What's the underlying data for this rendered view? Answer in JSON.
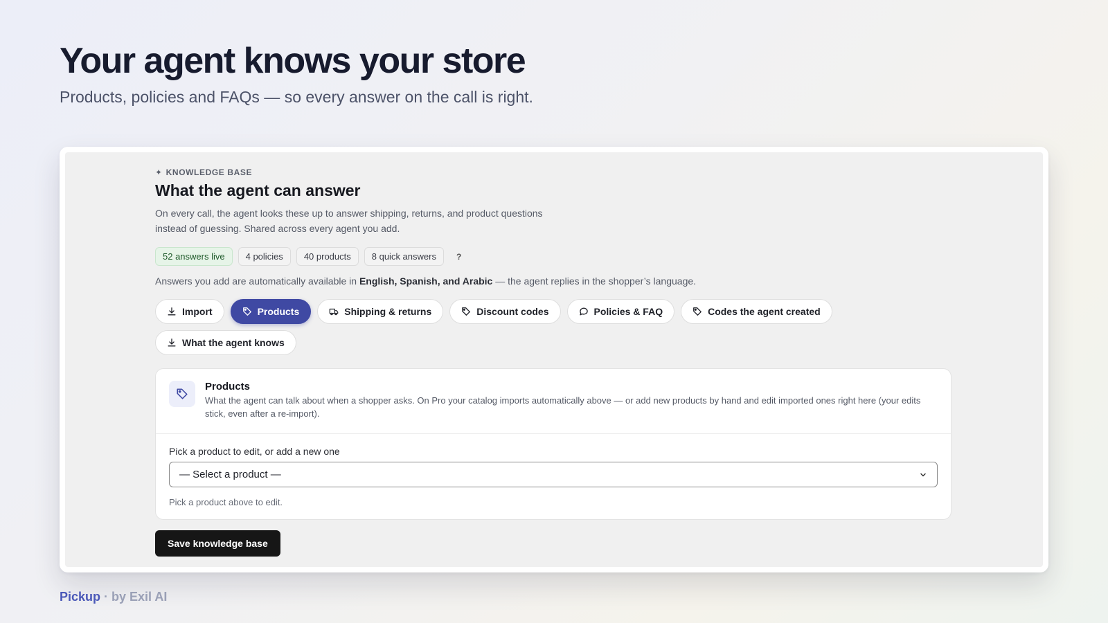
{
  "hero": {
    "title": "Your agent knows your store",
    "subtitle": "Products, policies and FAQs — so every answer on the call is right."
  },
  "kb": {
    "eyebrow": "KNOWLEDGE BASE",
    "title": "What the agent can answer",
    "description": "On every call, the agent looks these up to answer shipping, returns, and product questions instead of guessing. Shared across every agent you add.",
    "stats": {
      "live": "52 answers live",
      "policies": "4 policies",
      "products": "40 products",
      "quick": "8 quick answers",
      "help": "?"
    },
    "lang_note": {
      "prefix": "Answers you add are automatically available in ",
      "languages": "English, Spanish, and Arabic",
      "suffix": " — the agent replies in the shopper’s language."
    },
    "tabs": {
      "import": "Import",
      "products": "Products",
      "shipping": "Shipping & returns",
      "discounts": "Discount codes",
      "policies": "Policies & FAQ",
      "codes": "Codes the agent created",
      "knows": "What the agent knows"
    },
    "active_tab": "Products",
    "card": {
      "title": "Products",
      "description": "What the agent can talk about when a shopper asks. On Pro your catalog imports automatically above — or add new products by hand and edit imported ones right here (your edits stick, even after a re-import).",
      "field_label": "Pick a product to edit, or add a new one",
      "select_value": "— Select a product —",
      "hint": "Pick a product above to edit."
    },
    "save_label": "Save knowledge base"
  },
  "footer": {
    "brand": "Pickup",
    "byline": " · by Exil AI"
  },
  "colors": {
    "accent": "#3f49a3",
    "live_badge_bg": "#e6f4e8",
    "save_button": "#161616"
  }
}
